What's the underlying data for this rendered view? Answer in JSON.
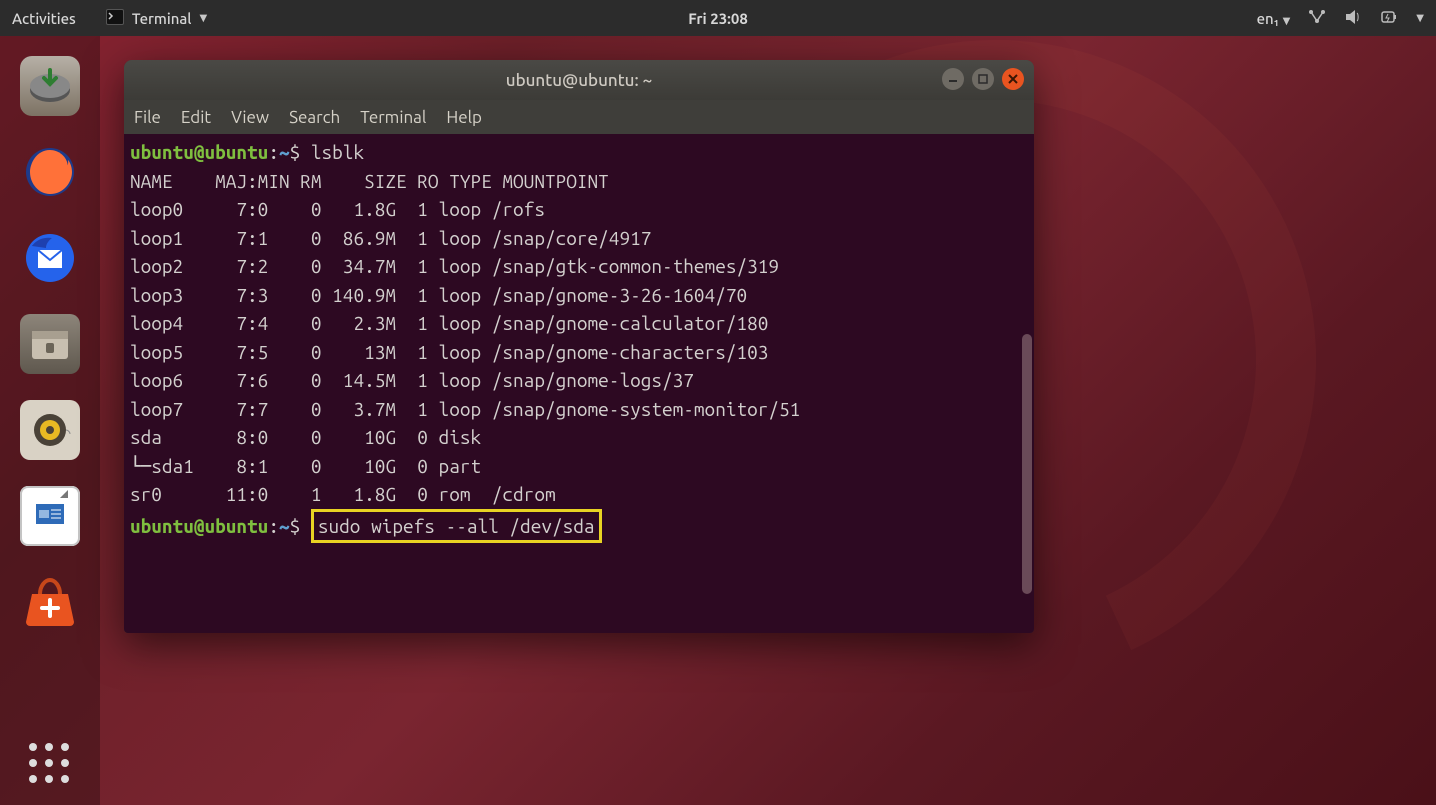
{
  "topbar": {
    "activities": "Activities",
    "app_label": "Terminal",
    "clock": "Fri 23:08",
    "lang": "en₁"
  },
  "window": {
    "title": "ubuntu@ubuntu: ~",
    "menus": {
      "file": "File",
      "edit": "Edit",
      "view": "View",
      "search": "Search",
      "terminal": "Terminal",
      "help": "Help"
    }
  },
  "term": {
    "prompt_user": "ubuntu@ubuntu",
    "prompt_path": "~",
    "dollar": "$",
    "cmd1": "lsblk",
    "header": "NAME    MAJ:MIN RM    SIZE RO TYPE MOUNTPOINT",
    "rows": [
      "loop0     7:0    0   1.8G  1 loop /rofs",
      "loop1     7:1    0  86.9M  1 loop /snap/core/4917",
      "loop2     7:2    0  34.7M  1 loop /snap/gtk-common-themes/319",
      "loop3     7:3    0 140.9M  1 loop /snap/gnome-3-26-1604/70",
      "loop4     7:4    0   2.3M  1 loop /snap/gnome-calculator/180",
      "loop5     7:5    0    13M  1 loop /snap/gnome-characters/103",
      "loop6     7:6    0  14.5M  1 loop /snap/gnome-logs/37",
      "loop7     7:7    0   3.7M  1 loop /snap/gnome-system-monitor/51",
      "sda       8:0    0    10G  0 disk ",
      "└─sda1    8:1    0    10G  0 part ",
      "sr0      11:0    1   1.8G  0 rom  /cdrom"
    ],
    "cmd2": "sudo wipefs --all /dev/sda"
  }
}
